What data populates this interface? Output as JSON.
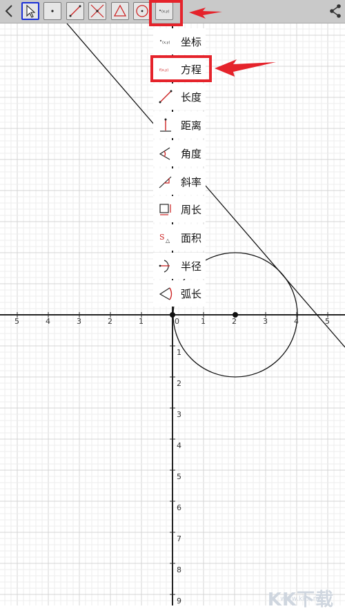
{
  "toolbar": {
    "back_icon": "chevron-left-icon",
    "tools": [
      "select-arrow-icon",
      "point-icon",
      "segment-icon",
      "intersection-icon",
      "triangle-icon",
      "circle-icon",
      "measure-icon"
    ],
    "share_icon": "share-icon"
  },
  "measure_menu": {
    "items": [
      {
        "label": "坐标",
        "icon": "coordinate-icon"
      },
      {
        "label": "方程",
        "icon": "equation-icon"
      },
      {
        "label": "长度",
        "icon": "length-icon"
      },
      {
        "label": "距离",
        "icon": "distance-icon"
      },
      {
        "label": "角度",
        "icon": "angle-icon"
      },
      {
        "label": "斜率",
        "icon": "slope-icon"
      },
      {
        "label": "周长",
        "icon": "perimeter-icon"
      },
      {
        "label": "面积",
        "icon": "area-icon"
      },
      {
        "label": "半径",
        "icon": "radius-icon"
      },
      {
        "label": "弧长",
        "icon": "arc-length-icon"
      }
    ]
  },
  "icon_text": {
    "coordinate": "(x,y)",
    "equation": "f(x,y)",
    "area_s": "S",
    "area_tri": "△"
  },
  "axes": {
    "x_labels": [
      "5",
      "4",
      "3",
      "2",
      "1",
      "0",
      "1",
      "2",
      "3",
      "4",
      "5"
    ],
    "y_labels": [
      "1",
      "2",
      "3",
      "4",
      "5",
      "6",
      "7",
      "8",
      "9"
    ]
  },
  "highlight_color": "#e5232b",
  "watermark": {
    "text": "KK下载",
    "url": "www.kkx.net"
  }
}
